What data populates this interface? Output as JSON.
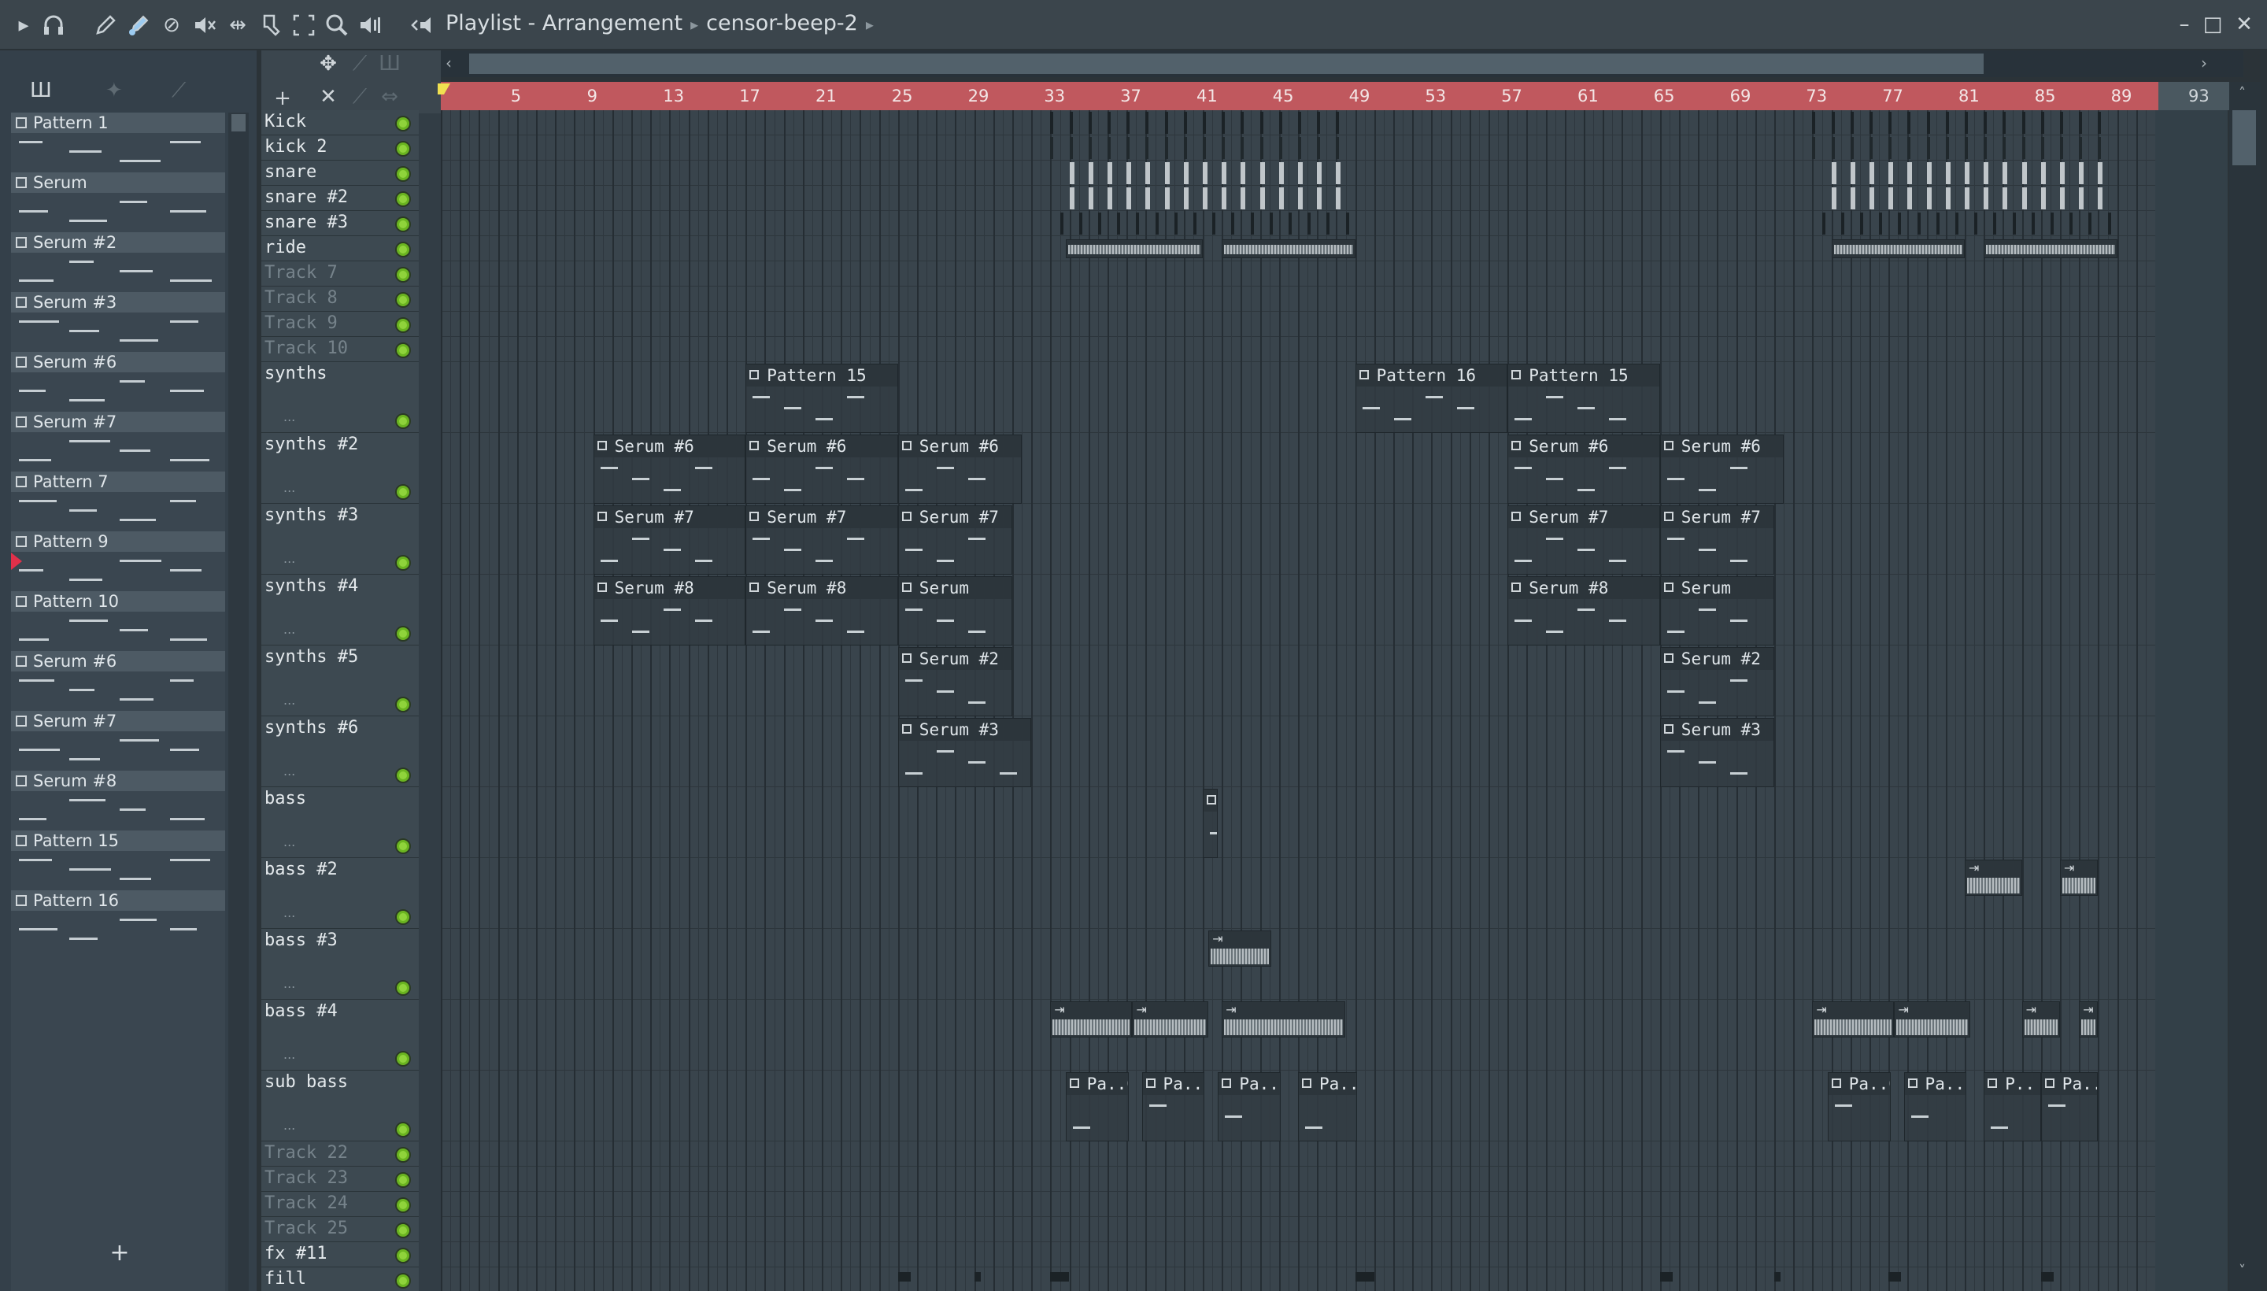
{
  "titlebar": {
    "title": "Playlist - Arrangement",
    "project": "censor-beep-2"
  },
  "picker": {
    "patterns": [
      "Pattern 1",
      "Serum",
      "Serum #2",
      "Serum #3",
      "Serum #6",
      "Serum #7",
      "Pattern 7",
      "Pattern 9",
      "Pattern 10",
      "Serum #6",
      "Serum #7",
      "Serum #8",
      "Pattern 15",
      "Pattern 16"
    ],
    "add_label": "+"
  },
  "tracks": [
    {
      "name": "Kick",
      "dim": false,
      "tall": false
    },
    {
      "name": "kick 2",
      "dim": false,
      "tall": false
    },
    {
      "name": "snare",
      "dim": false,
      "tall": false
    },
    {
      "name": "snare #2",
      "dim": false,
      "tall": false
    },
    {
      "name": "snare #3",
      "dim": false,
      "tall": false
    },
    {
      "name": "ride",
      "dim": false,
      "tall": false
    },
    {
      "name": "Track 7",
      "dim": true,
      "tall": false
    },
    {
      "name": "Track 8",
      "dim": true,
      "tall": false
    },
    {
      "name": "Track 9",
      "dim": true,
      "tall": false
    },
    {
      "name": "Track 10",
      "dim": true,
      "tall": false
    },
    {
      "name": "synths",
      "dim": false,
      "tall": true
    },
    {
      "name": "synths #2",
      "dim": false,
      "tall": true
    },
    {
      "name": "synths #3",
      "dim": false,
      "tall": true
    },
    {
      "name": "synths #4",
      "dim": false,
      "tall": true
    },
    {
      "name": "synths #5",
      "dim": false,
      "tall": true
    },
    {
      "name": "synths #6",
      "dim": false,
      "tall": true
    },
    {
      "name": "bass",
      "dim": false,
      "tall": true
    },
    {
      "name": "bass #2",
      "dim": false,
      "tall": true
    },
    {
      "name": "bass #3",
      "dim": false,
      "tall": true
    },
    {
      "name": "bass #4",
      "dim": false,
      "tall": true
    },
    {
      "name": "sub bass",
      "dim": false,
      "tall": true
    },
    {
      "name": "Track 22",
      "dim": true,
      "tall": false
    },
    {
      "name": "Track 23",
      "dim": true,
      "tall": false
    },
    {
      "name": "Track 24",
      "dim": true,
      "tall": false
    },
    {
      "name": "Track 25",
      "dim": true,
      "tall": false
    },
    {
      "name": "fx #11",
      "dim": false,
      "tall": false
    },
    {
      "name": "fill",
      "dim": false,
      "tall": false
    }
  ],
  "ruler": {
    "bars": [
      "5",
      "9",
      "13",
      "17",
      "21",
      "25",
      "29",
      "33",
      "37",
      "41",
      "45",
      "49",
      "53",
      "57",
      "61",
      "65",
      "69",
      "73",
      "77",
      "81",
      "85",
      "89",
      "93"
    ]
  },
  "clips": [
    {
      "track": 10,
      "bar": 17,
      "len": 8,
      "label": "Pattern 15"
    },
    {
      "track": 10,
      "bar": 49,
      "len": 8,
      "label": "Pattern 16"
    },
    {
      "track": 10,
      "bar": 57,
      "len": 8,
      "label": "Pattern 15"
    },
    {
      "track": 11,
      "bar": 9,
      "len": 8,
      "label": "Serum #6"
    },
    {
      "track": 11,
      "bar": 17,
      "len": 8,
      "label": "Serum #6"
    },
    {
      "track": 11,
      "bar": 25,
      "len": 6.5,
      "label": "Serum #6"
    },
    {
      "track": 11,
      "bar": 57,
      "len": 8,
      "label": "Serum #6"
    },
    {
      "track": 11,
      "bar": 65,
      "len": 6.5,
      "label": "Serum #6"
    },
    {
      "track": 12,
      "bar": 9,
      "len": 8,
      "label": "Serum #7"
    },
    {
      "track": 12,
      "bar": 17,
      "len": 8,
      "label": "Serum #7"
    },
    {
      "track": 12,
      "bar": 25,
      "len": 6,
      "label": "Serum #7"
    },
    {
      "track": 12,
      "bar": 57,
      "len": 8,
      "label": "Serum #7"
    },
    {
      "track": 12,
      "bar": 65,
      "len": 6,
      "label": "Serum #7"
    },
    {
      "track": 13,
      "bar": 9,
      "len": 8,
      "label": "Serum #8"
    },
    {
      "track": 13,
      "bar": 17,
      "len": 8,
      "label": "Serum #8"
    },
    {
      "track": 13,
      "bar": 25,
      "len": 6,
      "label": "Serum"
    },
    {
      "track": 13,
      "bar": 57,
      "len": 8,
      "label": "Serum #8"
    },
    {
      "track": 13,
      "bar": 65,
      "len": 6,
      "label": "Serum"
    },
    {
      "track": 14,
      "bar": 25,
      "len": 6,
      "label": "Serum #2"
    },
    {
      "track": 14,
      "bar": 65,
      "len": 6,
      "label": "Serum #2"
    },
    {
      "track": 15,
      "bar": 25,
      "len": 7,
      "label": "Serum #3"
    },
    {
      "track": 15,
      "bar": 65,
      "len": 6,
      "label": "Serum #3"
    },
    {
      "track": 16,
      "bar": 41,
      "len": 0.8,
      "label": ""
    },
    {
      "track": 20,
      "bar": 33.8,
      "len": 3.3,
      "label": "Pa..0"
    },
    {
      "track": 20,
      "bar": 37.8,
      "len": 3.3,
      "label": "Pa..0"
    },
    {
      "track": 20,
      "bar": 41.8,
      "len": 3.3,
      "label": "Pa..0"
    },
    {
      "track": 20,
      "bar": 46,
      "len": 3.1,
      "label": "Pa..0"
    },
    {
      "track": 20,
      "bar": 73.8,
      "len": 3.3,
      "label": "Pa..0"
    },
    {
      "track": 20,
      "bar": 77.8,
      "len": 3.3,
      "label": "Pa..0"
    },
    {
      "track": 20,
      "bar": 82,
      "len": 3,
      "label": "P.."
    },
    {
      "track": 20,
      "bar": 85,
      "len": 3,
      "label": "Pa..0"
    }
  ],
  "audio_clips": [
    {
      "track": 17,
      "bar": 81,
      "len": 3
    },
    {
      "track": 17,
      "bar": 86,
      "len": 2
    },
    {
      "track": 18,
      "bar": 41.3,
      "len": 3.3
    },
    {
      "track": 19,
      "bar": 33,
      "len": 4.3
    },
    {
      "track": 19,
      "bar": 37.3,
      "len": 4
    },
    {
      "track": 19,
      "bar": 42,
      "len": 6.5
    },
    {
      "track": 19,
      "bar": 73,
      "len": 4.3
    },
    {
      "track": 19,
      "bar": 77.3,
      "len": 4
    },
    {
      "track": 19,
      "bar": 84,
      "len": 2
    },
    {
      "track": 19,
      "bar": 87,
      "len": 1
    }
  ],
  "colors": {
    "ruler": "#c0585e",
    "led": "#8fd33b",
    "playhead": "#f0e050"
  }
}
